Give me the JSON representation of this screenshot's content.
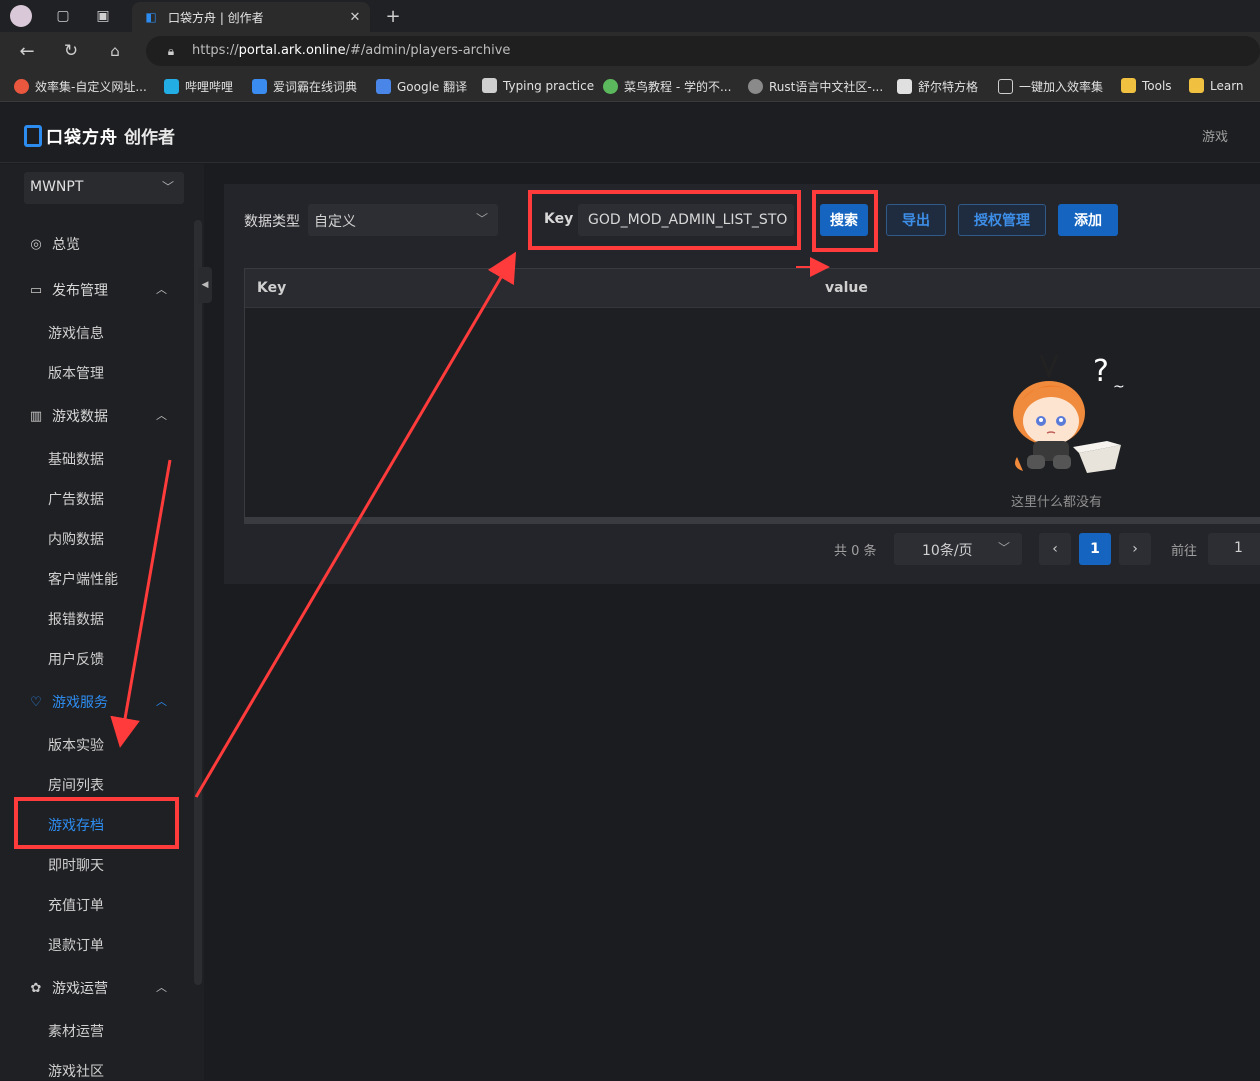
{
  "browser": {
    "tab_title": "口袋方舟 | 创作者",
    "url_scheme": "https://",
    "url_host": "portal.ark.online",
    "url_path": "/#/admin/players-archive",
    "bookmarks": [
      {
        "label": "效率集-自定义网址...",
        "color": "#e9573f"
      },
      {
        "label": "哔哩哔哩",
        "color": "#23ade5"
      },
      {
        "label": "爱词霸在线词典",
        "color": "#3b8cf0"
      },
      {
        "label": "Google 翻译",
        "color": "#4a86e8"
      },
      {
        "label": "Typing practice",
        "color": "#cfcfcf"
      },
      {
        "label": "菜鸟教程 - 学的不...",
        "color": "#5cb85c"
      },
      {
        "label": "Rust语言中文社区-...",
        "color": "#8a8a8a"
      },
      {
        "label": "舒尔特方格",
        "color": "#e0e0e0"
      },
      {
        "label": "一键加入效率集",
        "color": "#cfcfcf"
      },
      {
        "label": "Tools",
        "color": "#f0c040"
      },
      {
        "label": "Learn",
        "color": "#f0c040"
      }
    ]
  },
  "header": {
    "logo_text": "口袋方舟",
    "title": "创作者",
    "right_link": "游戏"
  },
  "sidebar": {
    "project": "MWNPT",
    "overview": "总览",
    "groups": {
      "publish": {
        "label": "发布管理",
        "items": [
          "游戏信息",
          "版本管理"
        ]
      },
      "data": {
        "label": "游戏数据",
        "items": [
          "基础数据",
          "广告数据",
          "内购数据",
          "客户端性能",
          "报错数据",
          "用户反馈"
        ]
      },
      "service": {
        "label": "游戏服务",
        "items": [
          "版本实验",
          "房间列表",
          "游戏存档",
          "即时聊天",
          "充值订单",
          "退款订单"
        ]
      },
      "ops": {
        "label": "游戏运营",
        "items": [
          "素材运营",
          "游戏社区"
        ]
      }
    },
    "active_item": "游戏存档"
  },
  "main": {
    "data_type_label": "数据类型",
    "data_type_value": "自定义",
    "key_label": "Key",
    "key_value": "GOD_MOD_ADMIN_LIST_STO",
    "buttons": {
      "search": "搜索",
      "export": "导出",
      "auth": "授权管理",
      "add": "添加"
    },
    "table": {
      "columns": [
        "Key",
        "value"
      ],
      "empty_text": "这里什么都没有"
    },
    "pagination": {
      "total": "共 0 条",
      "page_size": "10条/页",
      "current": "1",
      "goto_label": "前往",
      "goto_value": "1"
    }
  },
  "colors": {
    "accent": "#2d8cf0",
    "primary_button": "#1565c0",
    "annotation": "#ff3b3b"
  }
}
